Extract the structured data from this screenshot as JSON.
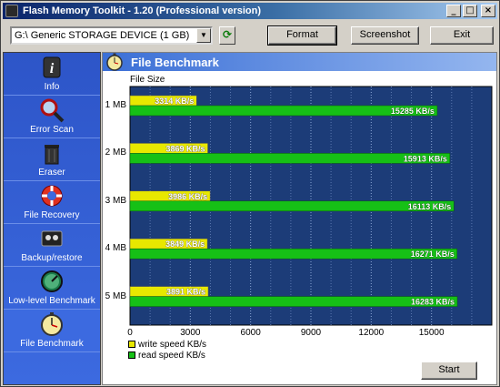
{
  "window": {
    "title": "Flash Memory Toolkit - 1.20 (Professional version)",
    "minimize": "_",
    "maximize": "□",
    "close": "×"
  },
  "toolbar": {
    "device": "G:\\ Generic STORAGE DEVICE (1 GB)",
    "format_label": "Format",
    "screenshot_label": "Screenshot",
    "exit_label": "Exit"
  },
  "sidebar": {
    "items": [
      {
        "label": "Info",
        "icon": "info-icon"
      },
      {
        "label": "Error Scan",
        "icon": "magnifier-icon"
      },
      {
        "label": "Eraser",
        "icon": "trash-icon"
      },
      {
        "label": "File Recovery",
        "icon": "lifebuoy-icon"
      },
      {
        "label": "Backup/restore",
        "icon": "tape-icon"
      },
      {
        "label": "Low-level Benchmark",
        "icon": "gauge-icon"
      },
      {
        "label": "File Benchmark",
        "icon": "stopwatch-icon"
      }
    ],
    "active": 6
  },
  "panel": {
    "title": "File Benchmark",
    "start_label": "Start"
  },
  "colors": {
    "write": "#e8e800",
    "read": "#16c016",
    "plot_bg": "#1c3c78"
  },
  "chart_data": {
    "type": "bar",
    "orientation": "horizontal",
    "ylabel": "File Size",
    "categories": [
      "1 MB",
      "2 MB",
      "3 MB",
      "4 MB",
      "5 MB"
    ],
    "series": [
      {
        "name": "write speed KB/s",
        "values": [
          3314,
          3869,
          3986,
          3849,
          3891
        ],
        "labels": [
          "3314 KB/s",
          "3869 KB/s",
          "3986 KB/s",
          "3849 KB/s",
          "3891 KB/s"
        ]
      },
      {
        "name": "read speed KB/s",
        "values": [
          15285,
          15913,
          16113,
          16271,
          16283
        ],
        "labels": [
          "15285 KB/s",
          "15913 KB/s",
          "16113 KB/s",
          "16271 KB/s",
          "16283 KB/s"
        ]
      }
    ],
    "xticks": [
      "0",
      "3000",
      "6000",
      "9000",
      "12000",
      "15000"
    ],
    "xlim": [
      0,
      18000
    ],
    "grid": true,
    "legend": "bottom-left"
  }
}
